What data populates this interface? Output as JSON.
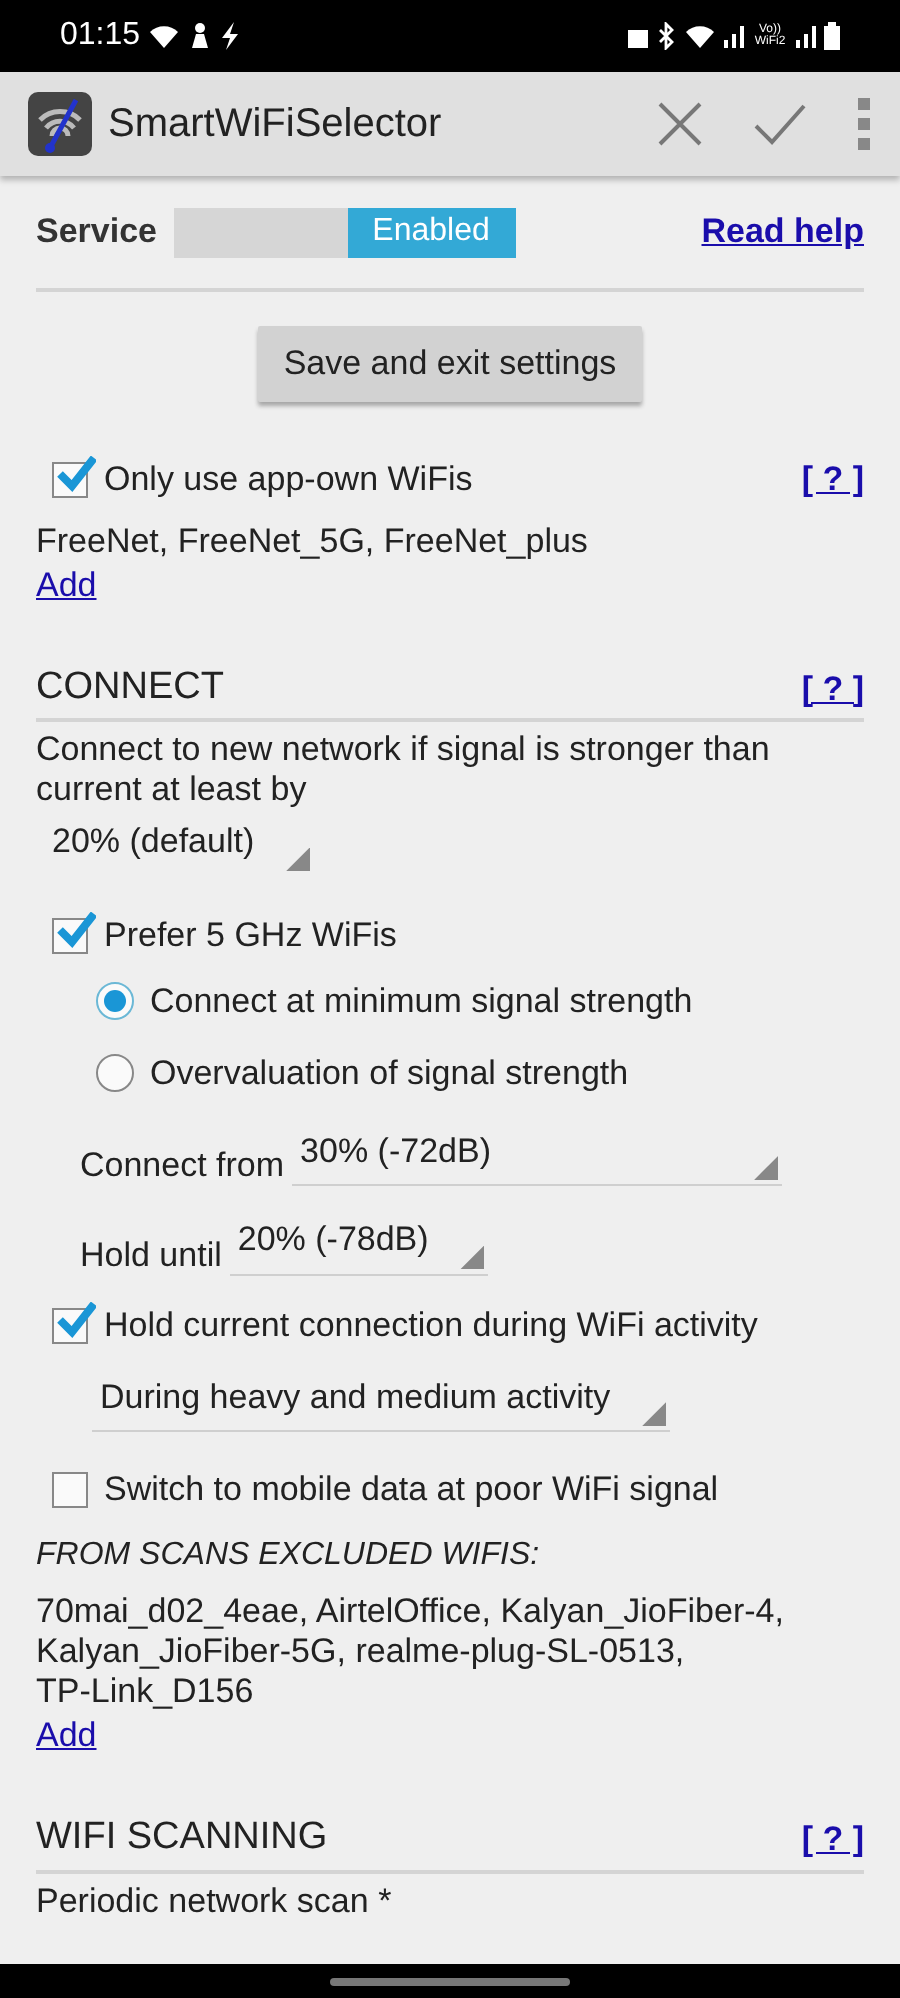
{
  "status_bar": {
    "time": "01:15",
    "network_label": "Vo)) WiFi2"
  },
  "app_bar": {
    "title": "SmartWiFiSelector"
  },
  "service": {
    "label": "Service",
    "on": true,
    "toggle_text": "Enabled",
    "help_link": "Read help"
  },
  "save_button": "Save and exit settings",
  "items": [
    {
      "kind": "checkbox",
      "label": "Only use app-own WiFis",
      "checked": true,
      "help": "[ ? ]"
    },
    {
      "kind": "text",
      "text": "FreeNet, FreeNet_5G, FreeNet_plus"
    },
    {
      "kind": "link",
      "text": "Add"
    },
    {
      "kind": "heading",
      "text": "CONNECT",
      "help": "[ ? ]"
    },
    {
      "kind": "text",
      "text": "Connect to new network if signal is stronger than current at least by"
    },
    {
      "kind": "spinner",
      "value": "20% (default)"
    },
    {
      "kind": "checkbox",
      "label": "Prefer 5 GHz WiFis",
      "checked": true,
      "children": [
        {
          "kind": "radio",
          "label": "Connect at minimum signal strength",
          "selected": true
        },
        {
          "kind": "radio",
          "label": "Overvaluation of signal strength",
          "selected": false
        },
        {
          "kind": "field_spinner",
          "label": "Connect from",
          "value": "30% (-72dB)"
        },
        {
          "kind": "field_spinner",
          "label": "Hold until",
          "value": "20% (-78dB)"
        }
      ]
    },
    {
      "kind": "checkbox",
      "label": "Hold current connection during WiFi activity",
      "checked": true,
      "children": [
        {
          "kind": "spinner",
          "value": "During heavy and medium activity"
        }
      ]
    },
    {
      "kind": "checkbox",
      "label": "Switch to mobile data at poor WiFi signal",
      "checked": false
    },
    {
      "kind": "caption",
      "text": "FROM SCANS EXCLUDED WIFIS:"
    },
    {
      "kind": "text",
      "text": "70mai_d02_4eae, AirtelOffice, Kalyan_JioFiber-4, Kalyan_JioFiber-5G, realme-plug-SL-0513, TP-Link_D156"
    },
    {
      "kind": "link",
      "text": "Add"
    },
    {
      "kind": "heading",
      "text": "WIFI SCANNING",
      "help": "[ ? ]"
    },
    {
      "kind": "text",
      "text": "Periodic network scan *"
    }
  ]
}
